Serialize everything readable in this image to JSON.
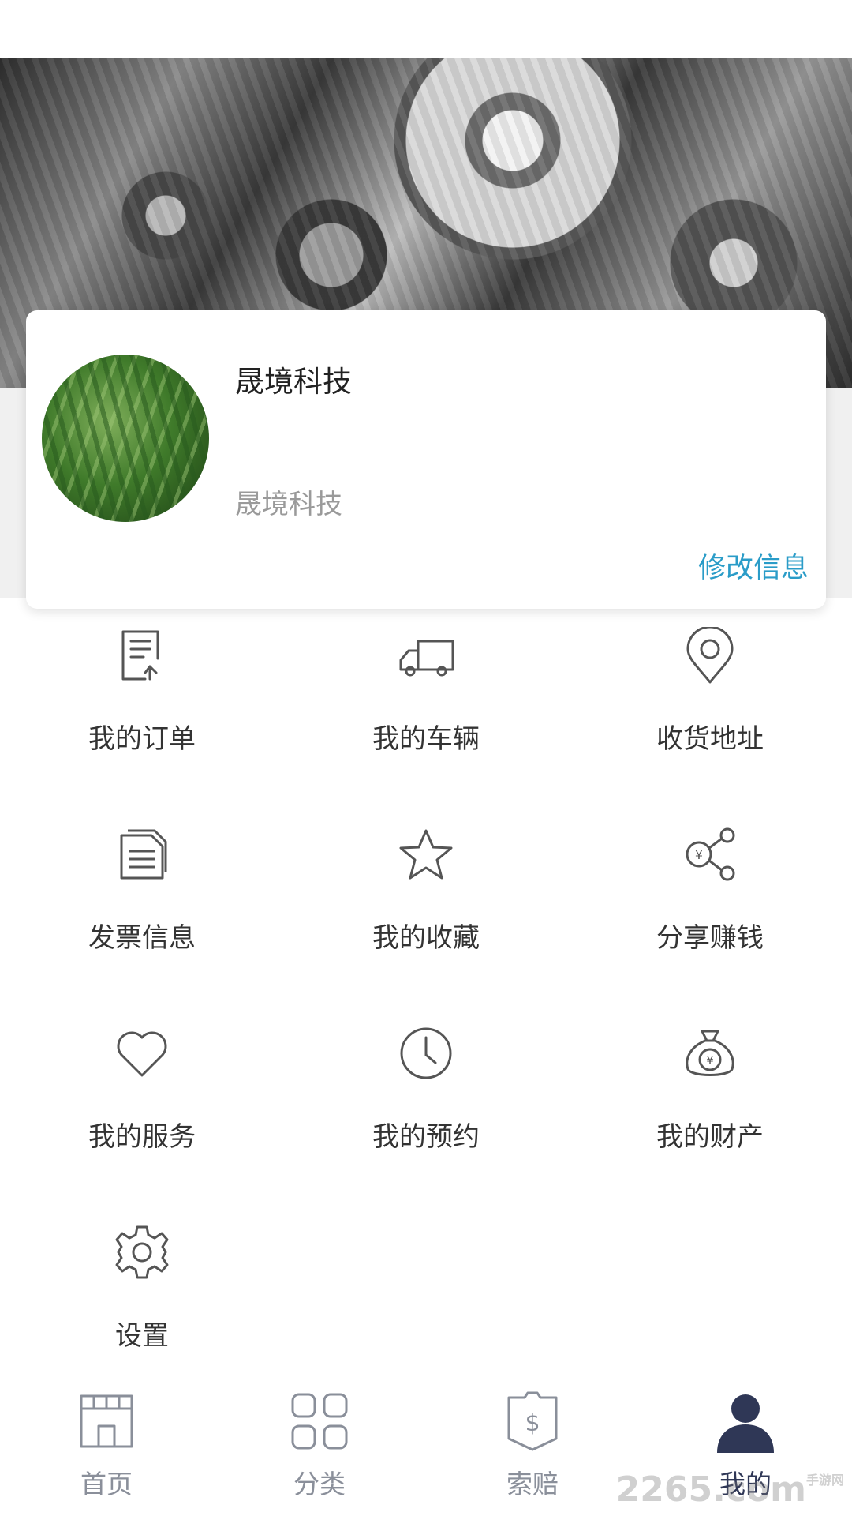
{
  "profile": {
    "name": "晟境科技",
    "subtitle": "晟境科技",
    "edit_label": "修改信息",
    "accent_color": "#2a9cc8"
  },
  "menu": {
    "items": [
      {
        "label": "我的订单",
        "icon": "order-icon"
      },
      {
        "label": "我的车辆",
        "icon": "truck-icon"
      },
      {
        "label": "收货地址",
        "icon": "location-pin-icon"
      },
      {
        "label": "发票信息",
        "icon": "invoice-icon"
      },
      {
        "label": "我的收藏",
        "icon": "star-icon"
      },
      {
        "label": "分享赚钱",
        "icon": "share-yen-icon"
      },
      {
        "label": "我的服务",
        "icon": "heart-icon"
      },
      {
        "label": "我的预约",
        "icon": "clock-icon"
      },
      {
        "label": "我的财产",
        "icon": "money-bag-icon"
      },
      {
        "label": "设置",
        "icon": "gear-icon"
      }
    ]
  },
  "tabbar": {
    "tabs": [
      {
        "label": "首页",
        "icon": "store-icon"
      },
      {
        "label": "分类",
        "icon": "grid-icon"
      },
      {
        "label": "索赔",
        "icon": "claim-icon"
      },
      {
        "label": "我的",
        "icon": "user-icon"
      }
    ],
    "active_index": 3,
    "active_color": "#2f3756"
  },
  "watermark": {
    "text": "2265",
    "suffix": ".com",
    "caption": "手游网"
  }
}
